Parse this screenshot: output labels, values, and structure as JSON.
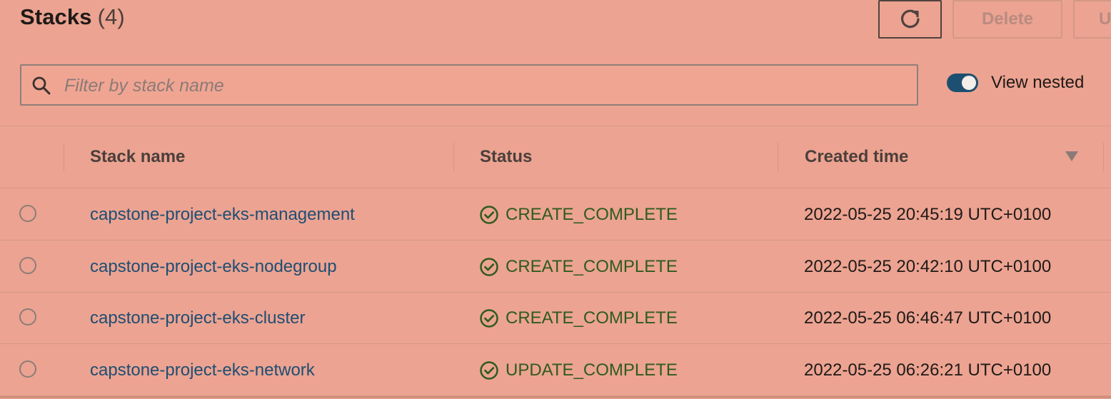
{
  "header": {
    "title": "Stacks",
    "count": "(4)",
    "refresh_button": "refresh-icon",
    "delete_label": "Delete",
    "update_label": "U"
  },
  "filter": {
    "placeholder": "Filter by stack name",
    "value": ""
  },
  "toggle": {
    "label": "View nested",
    "enabled": true
  },
  "table": {
    "columns": [
      "Stack name",
      "Status",
      "Created time"
    ],
    "rows": [
      {
        "name": "capstone-project-eks-management",
        "status": "CREATE_COMPLETE",
        "created": "2022-05-25 20:45:19 UTC+0100"
      },
      {
        "name": "capstone-project-eks-nodegroup",
        "status": "CREATE_COMPLETE",
        "created": "2022-05-25 20:42:10 UTC+0100"
      },
      {
        "name": "capstone-project-eks-cluster",
        "status": "CREATE_COMPLETE",
        "created": "2022-05-25 06:46:47 UTC+0100"
      },
      {
        "name": "capstone-project-eks-network",
        "status": "UPDATE_COMPLETE",
        "created": "2022-05-25 06:26:21 UTC+0100"
      }
    ]
  },
  "colors": {
    "background": "#eca391",
    "link": "#1e4e73",
    "success": "#2f5b1f",
    "toggle": "#1d4f70"
  },
  "icons": {
    "search": "search-icon",
    "refresh": "refresh-icon",
    "status_success": "check-circle-icon",
    "sort": "sort-down-icon"
  }
}
